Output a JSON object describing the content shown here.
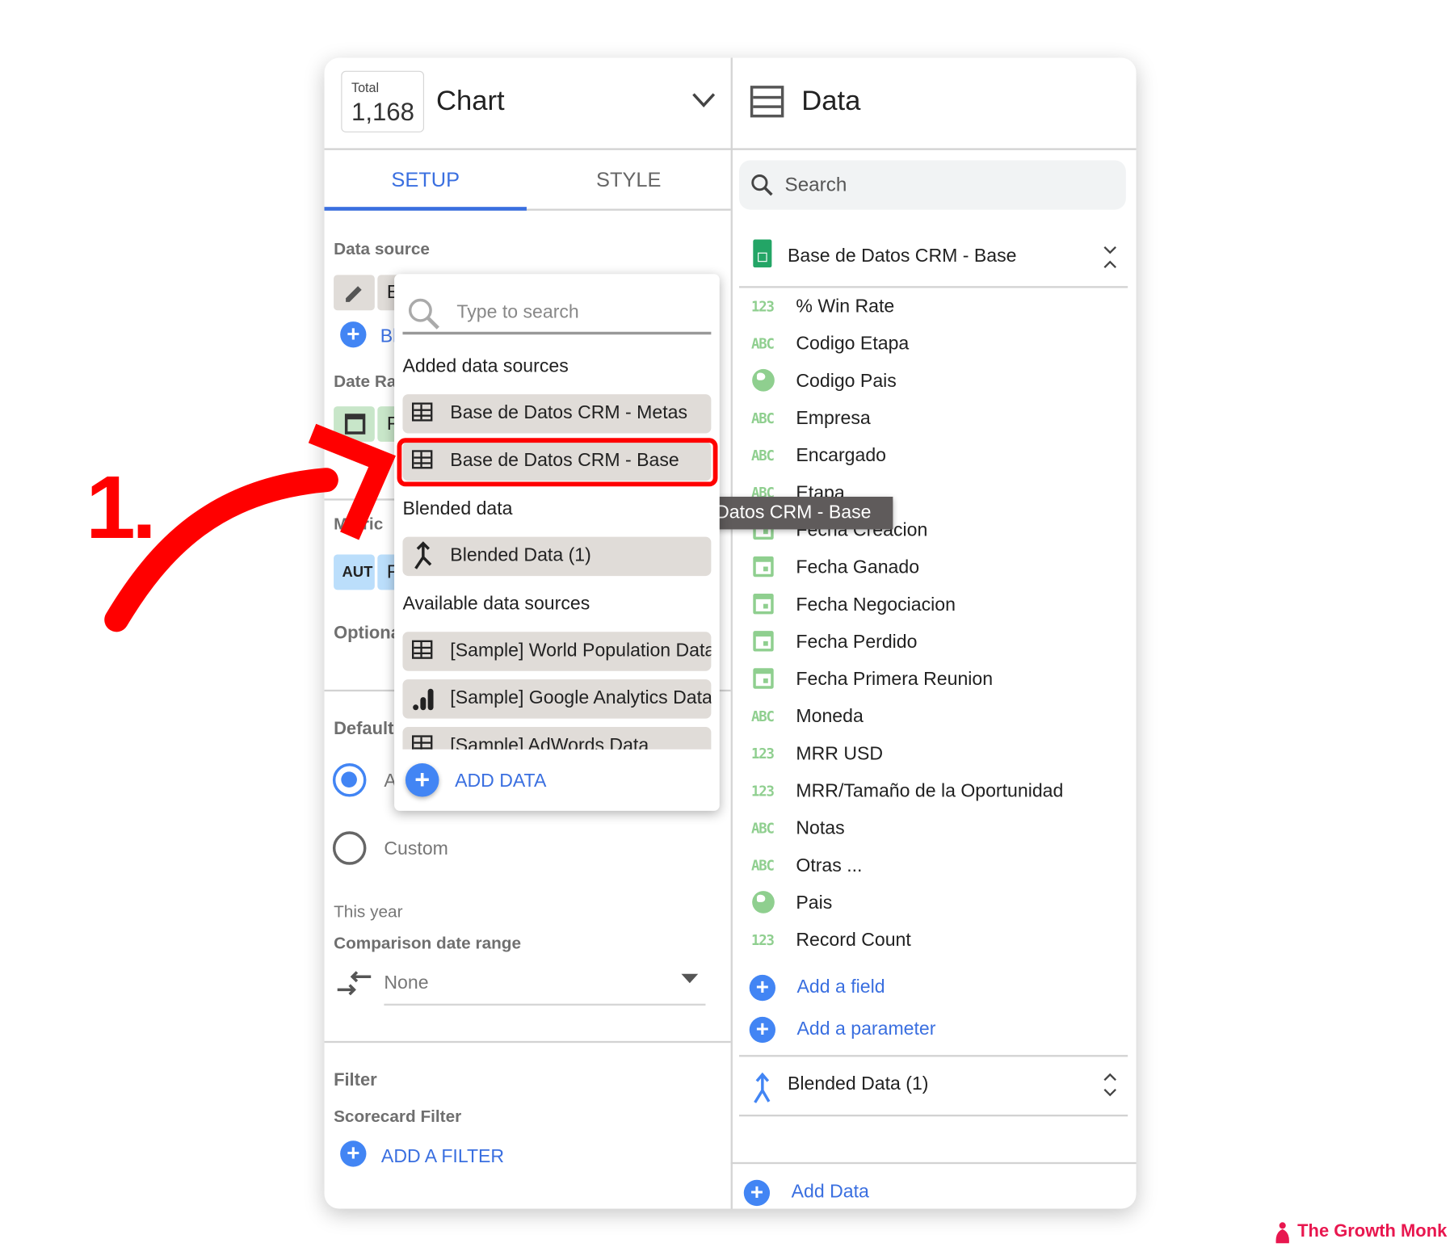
{
  "header": {
    "total_label": "Total",
    "total_value": "1,168",
    "chart_title": "Chart",
    "data_title": "Data"
  },
  "tabs": [
    {
      "label": "SETUP",
      "active": true
    },
    {
      "label": "STYLE",
      "active": false
    }
  ],
  "setup": {
    "data_source_label": "Data source",
    "data_source_value_partial": "E",
    "blend_partial": "Bl",
    "date_range_label_partial": "Date Ra",
    "date_chip_partial": "F",
    "metric_label_partial": "Metric",
    "metric_chip_partial": "AUT",
    "metric_chip2_partial": "F",
    "optional_label_partial": "Optiona",
    "default_label_partial": "Default",
    "radio_auto_partial": "A",
    "radio_custom": "Custom",
    "this_year": "This year",
    "comparison_label": "Comparison date range",
    "comparison_value": "None",
    "filter_label": "Filter",
    "scorecard_filter_label": "Scorecard Filter",
    "add_filter": "ADD A FILTER"
  },
  "dropdown": {
    "search_placeholder": "Type to search",
    "added_header": "Added data sources",
    "added": [
      "Base de Datos CRM - Metas",
      "Base de Datos CRM - Base"
    ],
    "blended_header": "Blended data",
    "blended": [
      "Blended Data (1)"
    ],
    "available_header": "Available data sources",
    "available": [
      "[Sample] World Population Data",
      "[Sample] Google Analytics Data",
      "[Sample] AdWords Data"
    ],
    "add_data": "ADD DATA",
    "tooltip": "Base de Datos CRM - Base"
  },
  "data_panel": {
    "search_placeholder": "Search",
    "source_name": "Base de Datos CRM - Base",
    "fields": [
      {
        "type": "123",
        "name": "% Win Rate"
      },
      {
        "type": "ABC",
        "name": "Codigo Etapa"
      },
      {
        "type": "geo",
        "name": "Codigo Pais"
      },
      {
        "type": "ABC",
        "name": "Empresa"
      },
      {
        "type": "ABC",
        "name": "Encargado"
      },
      {
        "type": "ABC",
        "name": "Etapa"
      },
      {
        "type": "date",
        "name": "Fecha Creacion"
      },
      {
        "type": "date",
        "name": "Fecha Ganado"
      },
      {
        "type": "date",
        "name": "Fecha Negociacion"
      },
      {
        "type": "date",
        "name": "Fecha Perdido"
      },
      {
        "type": "date",
        "name": "Fecha Primera Reunion"
      },
      {
        "type": "ABC",
        "name": "Moneda"
      },
      {
        "type": "123",
        "name": "MRR USD"
      },
      {
        "type": "123",
        "name": "MRR/Tamaño de la Oportunidad"
      },
      {
        "type": "ABC",
        "name": "Notas"
      },
      {
        "type": "ABC",
        "name": "Otras ..."
      },
      {
        "type": "geo",
        "name": "Pais"
      },
      {
        "type": "123",
        "name": "Record Count"
      }
    ],
    "add_field": "Add a field",
    "add_parameter": "Add a parameter",
    "blended_source": "Blended Data (1)",
    "add_data": "Add Data"
  },
  "annotation": {
    "step": "1."
  },
  "watermark": "The Growth Monk",
  "colors": {
    "accent": "#4285f4",
    "highlight": "#ff0000",
    "field_icon": "#8fcf8f",
    "brand": "#e8174f"
  }
}
